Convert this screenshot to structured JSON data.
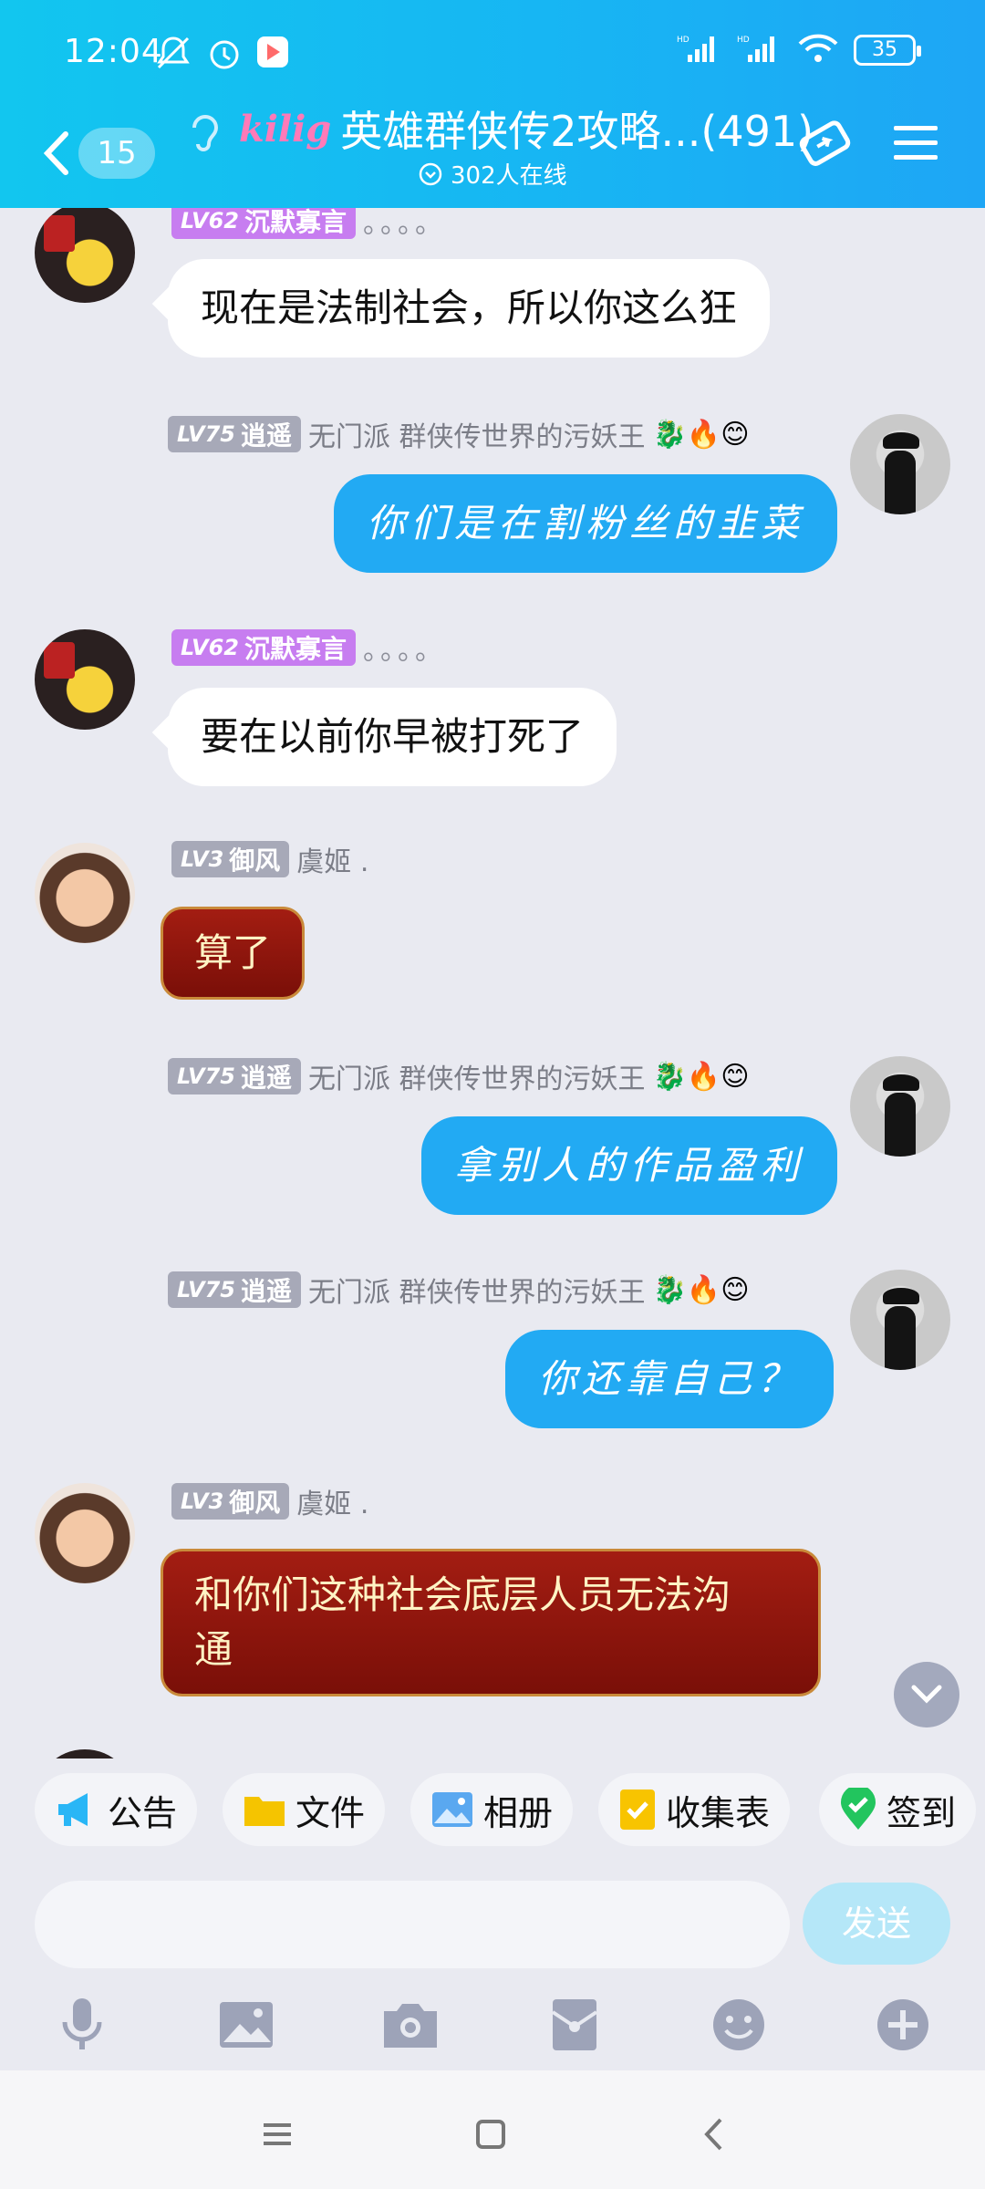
{
  "status_bar": {
    "time": "12:04",
    "battery": "35",
    "left_icons": [
      "mute-bell-icon",
      "alarm-icon",
      "play-store-icon"
    ],
    "right_icons": [
      "hd-signal-icon",
      "hd-signal-icon",
      "wifi-icon",
      "battery-icon"
    ]
  },
  "header": {
    "unread_count": "15",
    "logo_text": "kilig",
    "title": "英雄群侠传2攻略...(491)",
    "online": "302人在线",
    "accent": "#17b6f3"
  },
  "messages": [
    {
      "side": "left",
      "avatar": "pikachu-avatar",
      "level": "LV62",
      "title": "沉默寡言",
      "nick": "。。。。",
      "text": "现在是法制社会，所以你这么狂",
      "style": "white"
    },
    {
      "side": "right",
      "avatar": "black-hat-avatar",
      "level": "LV75",
      "title": "逍遥",
      "nick": "无门派 群侠传世界的污妖王",
      "emojis": "🐉🔥😊",
      "text": "你们是在割粉丝的韭菜",
      "style": "blue"
    },
    {
      "side": "left",
      "avatar": "pikachu-avatar",
      "level": "LV62",
      "title": "沉默寡言",
      "nick": "。。。。",
      "text": "要在以前你早被打死了",
      "style": "white"
    },
    {
      "side": "left",
      "avatar": "girl-avatar",
      "level": "LV3",
      "title": "御风",
      "nick": "虞姬 .",
      "text": "算了",
      "style": "red"
    },
    {
      "side": "right",
      "avatar": "black-hat-avatar",
      "level": "LV75",
      "title": "逍遥",
      "nick": "无门派 群侠传世界的污妖王",
      "emojis": "🐉🔥😊",
      "text": "拿别人的作品盈利",
      "style": "blue"
    },
    {
      "side": "right",
      "avatar": "black-hat-avatar",
      "level": "LV75",
      "title": "逍遥",
      "nick": "无门派 群侠传世界的污妖王",
      "emojis": "🐉🔥😊",
      "text": "你还靠自己？",
      "style": "blue"
    },
    {
      "side": "left",
      "avatar": "girl-avatar",
      "level": "LV3",
      "title": "御风",
      "nick": "虞姬 .",
      "text_line1": "和你们这种社会底层人员无法沟",
      "text_line2": "通",
      "style": "red"
    }
  ],
  "shortcuts": [
    "公告",
    "文件",
    "相册",
    "收集表",
    "签到"
  ],
  "input": {
    "placeholder": "",
    "send_label": "发送"
  },
  "toolbar_icons": [
    "microphone-icon",
    "image-icon",
    "camera-icon",
    "red-packet-icon",
    "emoji-icon",
    "plus-icon"
  ],
  "colors": {
    "blue_bubble": "#22aaf3",
    "red_bubble": "#8e1a10",
    "purple_badge": "#c77df0"
  }
}
